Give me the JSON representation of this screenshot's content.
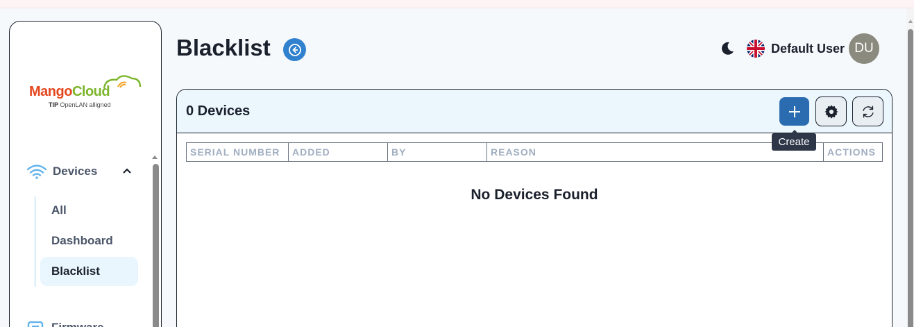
{
  "sidebar": {
    "logo": {
      "part1": "Mango",
      "part2": "Cloud",
      "tagline_brand": "TIP",
      "tagline_rest": "OpenLAN alligned"
    },
    "devices": {
      "label": "Devices",
      "icon": "wifi-icon",
      "expanded": true
    },
    "sub_items": [
      {
        "label": "All",
        "active": false
      },
      {
        "label": "Dashboard",
        "active": false
      },
      {
        "label": "Blacklist",
        "active": true
      }
    ],
    "firmware": {
      "label": "Firmware",
      "icon": "firmware-icon"
    }
  },
  "header": {
    "title": "Blacklist",
    "user_name": "Default User",
    "avatar_initials": "DU",
    "theme_icon": "moon-icon",
    "language_icon": "uk-flag-icon"
  },
  "card": {
    "title": "0 Devices",
    "buttons": {
      "create_icon": "plus-icon",
      "settings_icon": "gear-icon",
      "refresh_icon": "refresh-icon"
    },
    "tooltip": "Create",
    "columns": [
      "SERIAL NUMBER",
      "ADDED",
      "BY",
      "REASON",
      "ACTIONS"
    ],
    "rows": [],
    "empty_message": "No Devices Found"
  },
  "colors": {
    "accent": "#3182ce",
    "create_button": "#2b6cb0",
    "active_nav": "#e9f6fd",
    "card_header": "#ebf6fd"
  }
}
